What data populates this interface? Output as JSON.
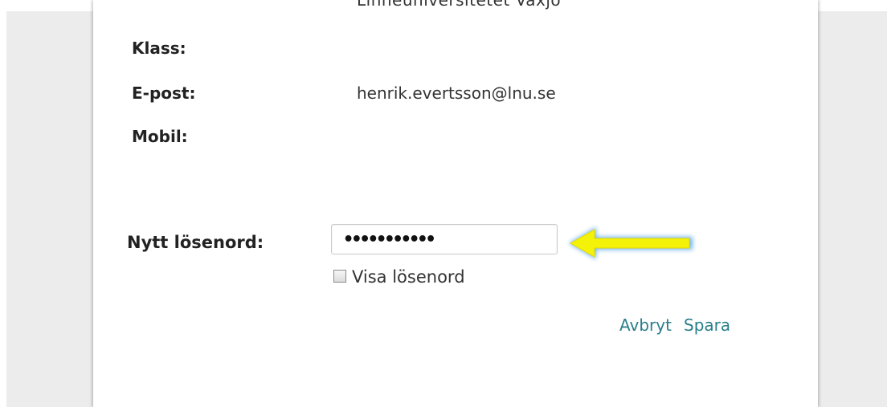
{
  "profile": {
    "cut_off_text": "Linnéuniversitetet Växjö",
    "rows": [
      {
        "label": "Klass:",
        "value": ""
      },
      {
        "label": "E-post:",
        "value": "henrik.evertsson@lnu.se"
      },
      {
        "label": "Mobil:",
        "value": ""
      }
    ]
  },
  "password": {
    "label": "Nytt lösenord:",
    "value": "•••••••••••",
    "show_label": "Visa lösenord",
    "show_checked": false
  },
  "actions": {
    "cancel_label": "Avbryt",
    "save_label": "Spara"
  },
  "annotation": {
    "arrow_icon": "left-arrow-icon",
    "arrow_color": "#f5f20a",
    "arrow_glow": "#5aa9e6"
  },
  "colors": {
    "background": "#ececec",
    "panel": "#ffffff",
    "link": "#2a7f8a",
    "label_text": "#222222"
  }
}
